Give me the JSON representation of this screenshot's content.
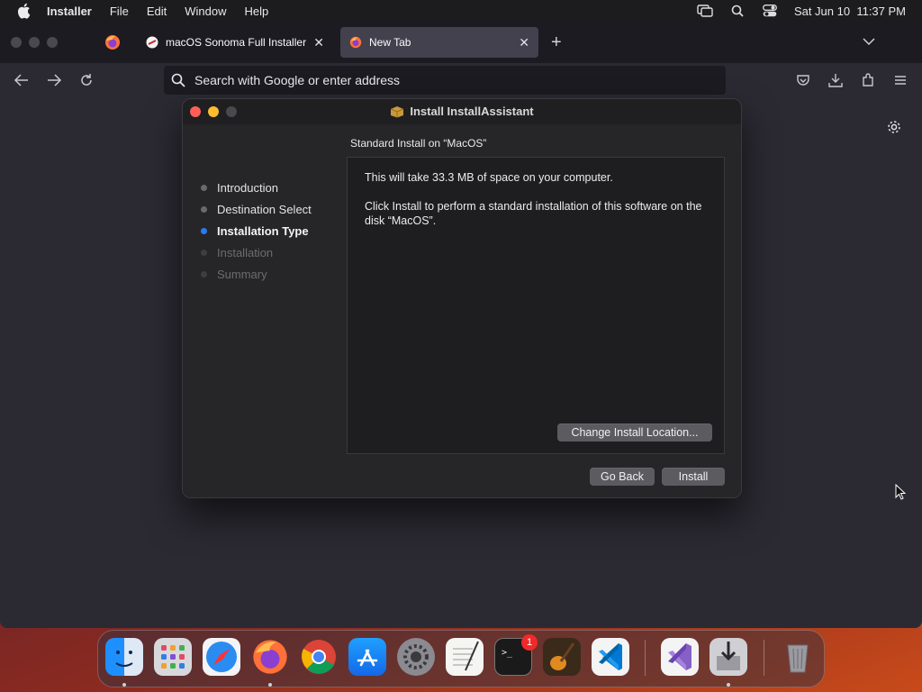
{
  "menubar": {
    "app_name": "Installer",
    "items": [
      "File",
      "Edit",
      "Window",
      "Help"
    ],
    "datetime": "Sat Jun 10  11:37 PM",
    "status_icons": [
      "screen-mirroring-icon",
      "spotlight-search-icon",
      "control-center-icon"
    ]
  },
  "browser": {
    "tabs": [
      {
        "title": "macOS Sonoma Full Installer Da",
        "active": false,
        "icon": "favicon"
      },
      {
        "title": "New Tab",
        "active": true,
        "icon": "firefox-icon"
      }
    ],
    "urlbar_placeholder": "Search with Google or enter address"
  },
  "installer": {
    "title": "Install InstallAssistant",
    "heading": "Standard Install on “MacOS”",
    "steps": [
      {
        "label": "Introduction",
        "state": "done"
      },
      {
        "label": "Destination Select",
        "state": "done"
      },
      {
        "label": "Installation Type",
        "state": "current"
      },
      {
        "label": "Installation",
        "state": "future"
      },
      {
        "label": "Summary",
        "state": "future"
      }
    ],
    "message_space": "This will take 33.3 MB of space on your computer.",
    "message_instruction": "Click Install to perform a standard installation of this software on the disk “MacOS”.",
    "change_location_label": "Change Install Location...",
    "go_back_label": "Go Back",
    "install_label": "Install"
  },
  "dock": {
    "apps": [
      "finder-icon",
      "launchpad-icon",
      "safari-icon",
      "firefox-icon",
      "chrome-icon",
      "app-store-icon",
      "system-settings-icon",
      "textedit-icon",
      "terminal-icon",
      "garageband-icon",
      "vscode-icon",
      "visual-studio-icon",
      "installer-icon",
      "trash-icon"
    ],
    "badge_count": "1"
  },
  "colors": {
    "accent": "#2a7bf3",
    "close": "#ff5f57",
    "minimize": "#febc2e",
    "maximize": "#4a4a4e"
  }
}
